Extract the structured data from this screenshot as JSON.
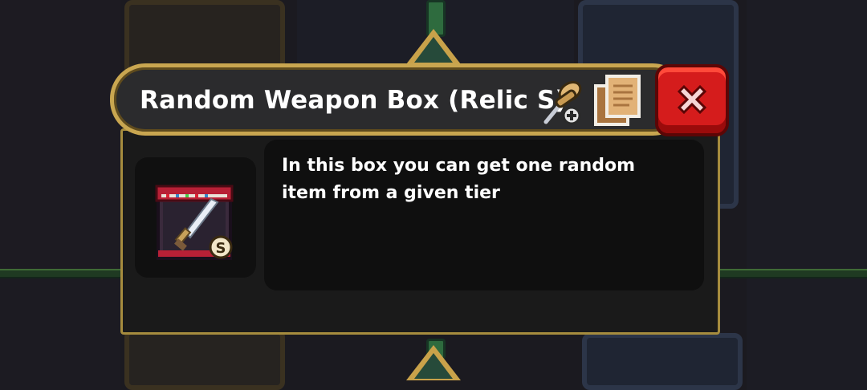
{
  "dialog": {
    "title": "Random Weapon Box (Relic S)",
    "description": "In this box you can get one random item from a given tier",
    "item": {
      "icon": "random-weapon-box-icon",
      "tier_badge": "S"
    },
    "buttons": {
      "pin": "pin-add-icon",
      "copy": "copy-notes-icon",
      "close": "close-x-icon"
    }
  },
  "colors": {
    "frame_gold": "#c9a650",
    "close_red": "#d51c1c",
    "panel_dark": "#0f0f0f",
    "text": "#ffffff"
  }
}
